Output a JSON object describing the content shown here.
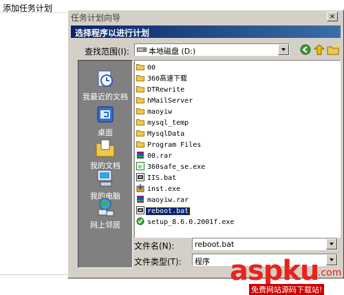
{
  "background": {
    "title": "添加任务计划"
  },
  "dialog": {
    "outer_title": "任务计划向导",
    "close_symbol": "×",
    "inner_title": "选择程序以进行计划",
    "look_in": {
      "label": "查找范围(I):",
      "value": "本地磁盘 (D:)"
    },
    "places": [
      {
        "label": "我最近的文档",
        "icon": "recent-documents-icon"
      },
      {
        "label": "桌面",
        "icon": "desktop-icon"
      },
      {
        "label": "我的文档",
        "icon": "my-documents-icon"
      },
      {
        "label": "我的电脑",
        "icon": "my-computer-icon"
      },
      {
        "label": "网上邻居",
        "icon": "network-places-icon"
      }
    ],
    "files": [
      {
        "name": "00",
        "icon": "folder-icon"
      },
      {
        "name": "360高速下载",
        "icon": "folder-icon"
      },
      {
        "name": "DTRewrite",
        "icon": "folder-icon"
      },
      {
        "name": "hMailServer",
        "icon": "folder-icon"
      },
      {
        "name": "maoyiw",
        "icon": "folder-icon"
      },
      {
        "name": "mysql_temp",
        "icon": "folder-icon"
      },
      {
        "name": "MysqlData",
        "icon": "folder-icon"
      },
      {
        "name": "Program Files",
        "icon": "folder-icon"
      },
      {
        "name": "00.rar",
        "icon": "rar-file-icon"
      },
      {
        "name": "360safe_se.exe",
        "icon": "exe-file-icon"
      },
      {
        "name": "IIS.bat",
        "icon": "bat-file-icon"
      },
      {
        "name": "inst.exe",
        "icon": "installer-icon"
      },
      {
        "name": "maoyiw.rar",
        "icon": "rar-file-icon"
      },
      {
        "name": "reboot.bat",
        "icon": "bat-file-icon",
        "selected": true
      },
      {
        "name": "setup_8.6.0.2001f.exe",
        "icon": "setup-exe-icon"
      }
    ],
    "filename": {
      "label": "文件名(N):",
      "value": "reboot.bat"
    },
    "filetype": {
      "label": "文件类型(T):",
      "value": "程序"
    }
  },
  "watermark": {
    "main": "aspku",
    "suffix": ".com",
    "sub": "免费网站源码下载站!"
  },
  "colors": {
    "dialog_face": "#d4d0c8",
    "title_active": "#0a246a",
    "places_bg": "#808080",
    "watermark_red": "#e8231d"
  }
}
